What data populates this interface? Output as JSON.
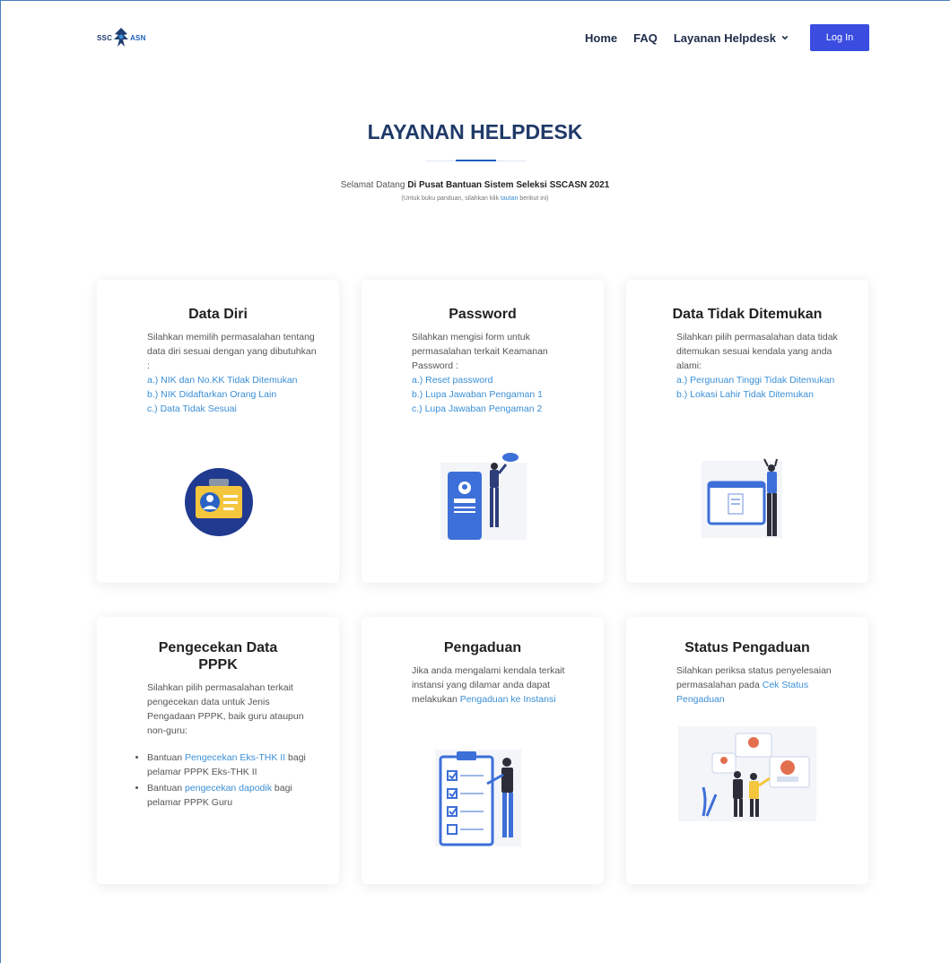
{
  "header": {
    "logo": {
      "left": "SSC",
      "right": "ASN"
    },
    "nav": {
      "home": "Home",
      "faq": "FAQ",
      "helpdesk": "Layanan Helpdesk",
      "login": "Log In"
    }
  },
  "hero": {
    "title": "LAYANAN HELPDESK",
    "welcome_prefix": "Selamat Datang ",
    "welcome_bold": "Di Pusat Bantuan Sistem Seleksi SSCASN 2021",
    "guide_prefix": "(Untuk buku panduan, silahkan klik ",
    "guide_link": "tautan",
    "guide_suffix": " berikut ini)"
  },
  "cards": {
    "data_diri": {
      "title": "Data Diri",
      "desc": "Silahkan memilih permasalahan tentang data diri sesuai dengan yang dibutuhkan :",
      "links": [
        "a.) NIK dan No.KK Tidak Ditemukan",
        "b.) NIK Didaftarkan Orang Lain",
        "c.) Data Tidak Sesuai"
      ]
    },
    "password": {
      "title": "Password",
      "desc": "Silahkan mengisi form untuk permasalahan terkait Keamanan Password :",
      "links": [
        "a.) Reset password",
        "b.) Lupa Jawaban Pengaman 1",
        "c.) Lupa Jawaban Pengaman 2"
      ]
    },
    "data_tidak_ditemukan": {
      "title": "Data Tidak Ditemukan",
      "desc": "Silahkan pilih permasalahan data tidak ditemukan sesuai kendala yang anda alami:",
      "links": [
        "a.) Perguruan Tinggi Tidak Ditemukan",
        "b.) Lokasi Lahir Tidak Ditemukan"
      ]
    },
    "pppk": {
      "title": "Pengecekan Data PPPK",
      "desc": "Silahkan pilih permasalahan terkait pengecekan data untuk Jenis Pengadaan PPPK, baik guru ataupun non-guru:",
      "items": [
        {
          "prefix": "Bantuan ",
          "link": "Pengecekan Eks-THK II",
          "suffix": " bagi pelamar PPPK Eks-THK II"
        },
        {
          "prefix": "Bantuan ",
          "link": "pengecekan dapodik",
          "suffix": " bagi pelamar PPPK Guru"
        }
      ]
    },
    "pengaduan": {
      "title": "Pengaduan",
      "desc": "Jika anda mengalami kendala terkait instansi yang dilamar anda dapat melakukan ",
      "link": "Pengaduan ke Instansi"
    },
    "status": {
      "title": "Status Pengaduan",
      "desc": "Silahkan periksa status penyelesaian permasalahan pada ",
      "link": "Cek Status Pengaduan"
    }
  },
  "colors": {
    "primary": "#3b4de0",
    "link": "#3a8fd6",
    "heading": "#203a68"
  }
}
